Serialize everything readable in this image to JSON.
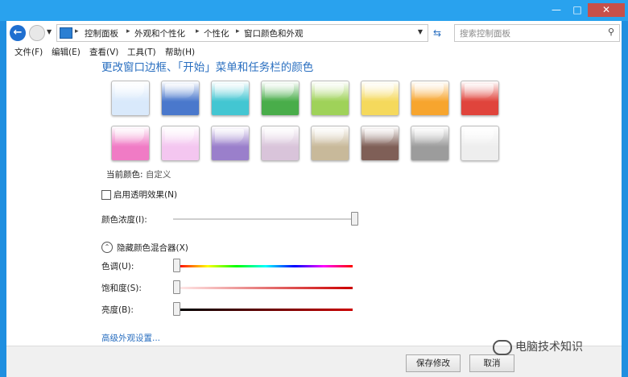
{
  "address": {
    "breadcrumbs": [
      "控制面板",
      "外观和个性化",
      "个性化",
      "窗口颜色和外观"
    ],
    "search_placeholder": "搜索控制面板"
  },
  "menu": [
    "文件(F)",
    "编辑(E)",
    "查看(V)",
    "工具(T)",
    "帮助(H)"
  ],
  "heading": "更改窗口边框、「开始」菜单和任务栏的颜色",
  "swatch_colors": [
    "#d9e9fb",
    "#4a78cc",
    "#43c6d2",
    "#49ad4a",
    "#9fd259",
    "#f5d95c",
    "#f7a52e",
    "#e0443c",
    "#f07bc5",
    "#f4c6f0",
    "#9a7fcb",
    "#d9c4da",
    "#c8b99a",
    "#7f5f57",
    "#9c9c9c",
    "#eeeeee"
  ],
  "current_color_label": "当前颜色:",
  "current_color_value": "自定义",
  "transparency_label": "启用透明效果(N)",
  "transparency_checked": false,
  "intensity_label": "颜色浓度(I):",
  "intensity_value": 1.0,
  "mixer_label": "隐藏颜色混合器(X)",
  "hue_label": "色调(U):",
  "hue_value": 0.0,
  "saturation_label": "饱和度(S):",
  "saturation_value": 0.0,
  "brightness_label": "亮度(B):",
  "brightness_value": 0.0,
  "advanced_link": "高级外观设置...",
  "save_button": "保存修改",
  "cancel_button": "取消",
  "watermark": "电脑技术知识",
  "colors": {
    "accent": "#2a6fc0",
    "titlebar": "#29a2ee",
    "close": "#c7504a"
  }
}
